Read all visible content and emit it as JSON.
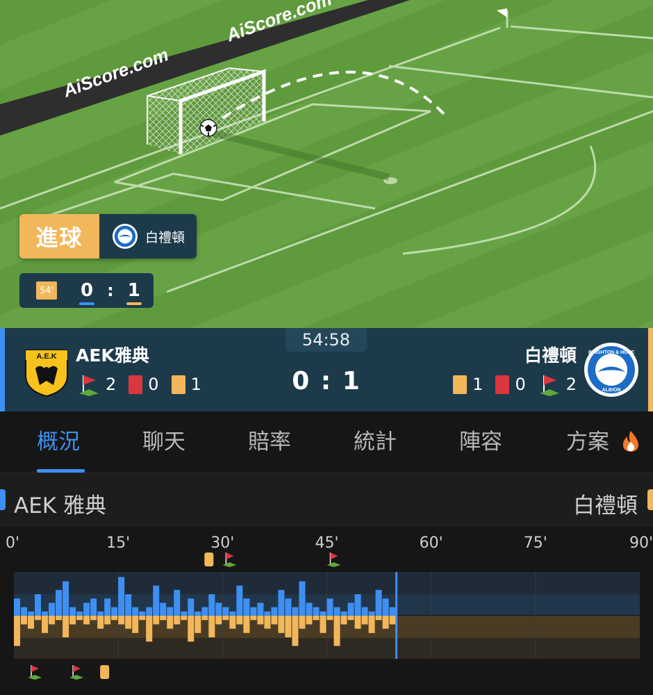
{
  "brand": {
    "watermark": "AiScore.com"
  },
  "event": {
    "type_label": "進球",
    "team": "白禮頓"
  },
  "mini_score": {
    "minute": "54'",
    "home": "0",
    "away": "1"
  },
  "match": {
    "clock": "54:58",
    "score": "0 : 1",
    "home": {
      "name": "AEK雅典",
      "corners": "2",
      "red_cards": "0",
      "yellow_cards": "1"
    },
    "away": {
      "name": "白禮頓",
      "corners": "2",
      "red_cards": "0",
      "yellow_cards": "1"
    }
  },
  "tabs": [
    {
      "label": "概況",
      "active": true
    },
    {
      "label": "聊天"
    },
    {
      "label": "賠率"
    },
    {
      "label": "統計"
    },
    {
      "label": "陣容"
    },
    {
      "label": "方案",
      "icon": "fire-icon"
    }
  ],
  "timeline": {
    "home_label": "AEK 雅典",
    "away_label": "白禮頓",
    "minute_ticks": [
      "0'",
      "15'",
      "30'",
      "45'",
      "60'",
      "75'",
      "90'"
    ],
    "current_minute": 55,
    "home_events": [
      {
        "minute": 28,
        "type": "yellow-card"
      },
      {
        "minute": 31,
        "type": "corner"
      },
      {
        "minute": 46,
        "type": "corner"
      }
    ],
    "away_events": [
      {
        "minute": 3,
        "type": "corner"
      },
      {
        "minute": 9,
        "type": "corner"
      },
      {
        "minute": 13,
        "type": "yellow-card"
      }
    ],
    "colors": {
      "home": "#3e8ff2",
      "away": "#f2b75b"
    }
  },
  "chart_data": {
    "type": "bar",
    "x_unit": "minute",
    "xlim": [
      0,
      90
    ],
    "ylim": [
      -1,
      1
    ],
    "series": [
      {
        "name": "AEK 雅典",
        "values": [
          0.4,
          0.2,
          0.1,
          0.5,
          0.1,
          0.3,
          0.6,
          0.8,
          0.2,
          0.1,
          0.3,
          0.4,
          0.1,
          0.4,
          0.2,
          0.9,
          0.5,
          0.2,
          0.1,
          0.2,
          0.7,
          0.3,
          0.2,
          0.6,
          0.1,
          0.4,
          0.1,
          0.2,
          0.5,
          0.3,
          0.2,
          0.1,
          0.7,
          0.4,
          0.2,
          0.3,
          0.1,
          0.2,
          0.6,
          0.4,
          0.2,
          0.8,
          0.3,
          0.2,
          0.1,
          0.4,
          0.2,
          0.1,
          0.3,
          0.5,
          0.2,
          0.1,
          0.6,
          0.4,
          0.2
        ]
      },
      {
        "name": "白禮頓",
        "values": [
          0.7,
          0.2,
          0.3,
          0.1,
          0.4,
          0.2,
          0.1,
          0.5,
          0.2,
          0.1,
          0.2,
          0.1,
          0.3,
          0.2,
          0.1,
          0.2,
          0.3,
          0.4,
          0.1,
          0.6,
          0.2,
          0.1,
          0.3,
          0.2,
          0.1,
          0.6,
          0.4,
          0.1,
          0.5,
          0.2,
          0.1,
          0.3,
          0.2,
          0.4,
          0.1,
          0.2,
          0.3,
          0.2,
          0.4,
          0.5,
          0.7,
          0.3,
          0.2,
          0.1,
          0.4,
          0.1,
          0.7,
          0.2,
          0.1,
          0.3,
          0.2,
          0.4,
          0.1,
          0.3,
          0.2
        ]
      }
    ]
  }
}
